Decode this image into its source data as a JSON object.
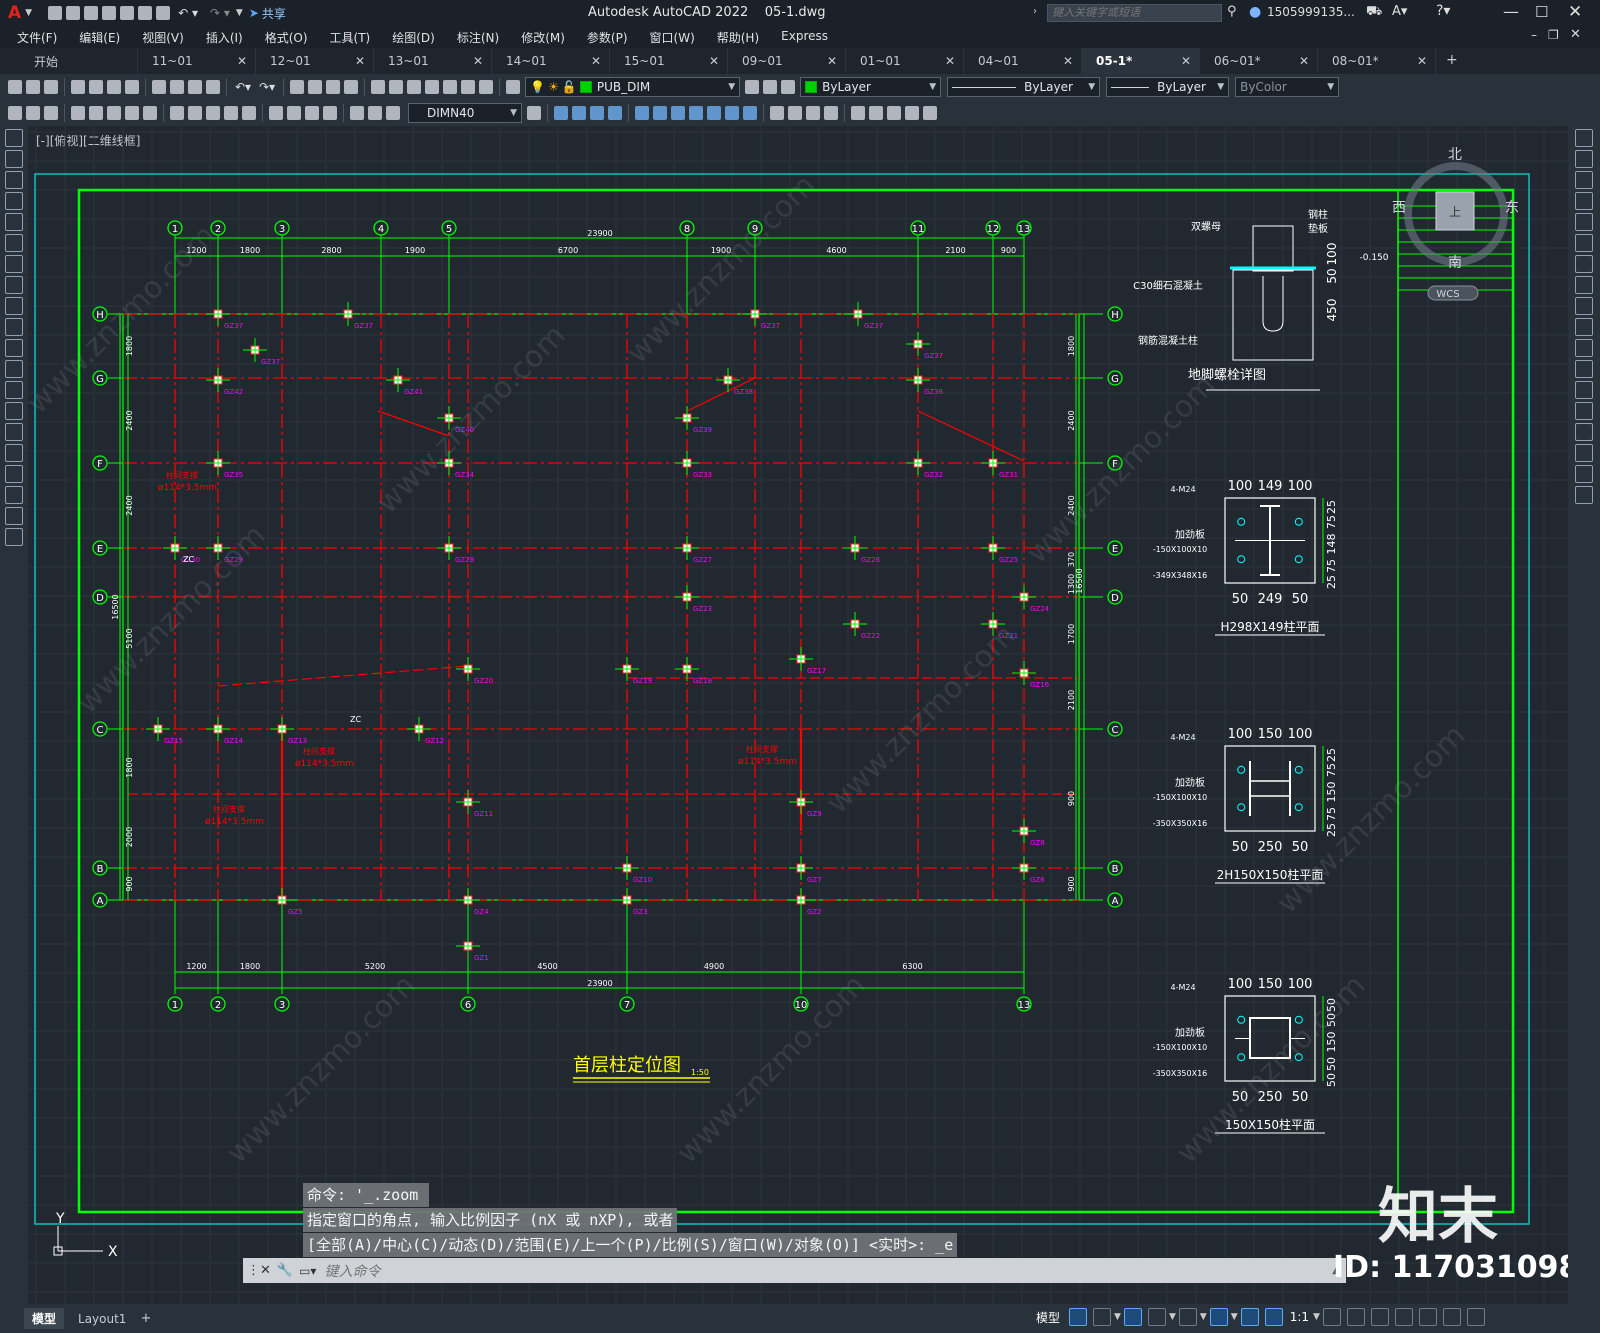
{
  "app": {
    "title": "Autodesk AutoCAD 2022    05-1.dwg",
    "logo": "A",
    "share_label": "共享",
    "search_placeholder": "键入关键字或短语",
    "user": "1505999135...",
    "colors": {
      "accent": "#0078d7",
      "model_bg": "#212830",
      "grid_green": "#00ff00",
      "column_red": "#ff0000",
      "label_magenta": "#ff00ff",
      "text_white": "#ffffff",
      "title_yellow": "#ffff00"
    }
  },
  "menu": [
    "文件(F)",
    "编辑(E)",
    "视图(V)",
    "插入(I)",
    "格式(O)",
    "工具(T)",
    "绘图(D)",
    "标注(N)",
    "修改(M)",
    "参数(P)",
    "窗口(W)",
    "帮助(H)",
    "Express"
  ],
  "tabs": [
    {
      "label": "开始",
      "closable": false,
      "active": false
    },
    {
      "label": "11~01",
      "closable": true,
      "active": false
    },
    {
      "label": "12~01",
      "closable": true,
      "active": false
    },
    {
      "label": "13~01",
      "closable": true,
      "active": false
    },
    {
      "label": "14~01",
      "closable": true,
      "active": false
    },
    {
      "label": "15~01",
      "closable": true,
      "active": false
    },
    {
      "label": "09~01",
      "closable": true,
      "active": false
    },
    {
      "label": "01~01",
      "closable": true,
      "active": false
    },
    {
      "label": "04~01",
      "closable": true,
      "active": false
    },
    {
      "label": "05-1*",
      "closable": true,
      "active": true
    },
    {
      "label": "06~01*",
      "closable": true,
      "active": false
    },
    {
      "label": "08~01*",
      "closable": true,
      "active": false
    }
  ],
  "toolbar": {
    "layer": "PUB_DIM",
    "color": "ByLayer",
    "linetype": "ByLayer",
    "lineweight": "ByLayer",
    "plotstyle": "ByColor",
    "dimstyle": "DIMN40"
  },
  "viewport_label": "[-][俯视][二维线框]",
  "viewcube": {
    "north": "北",
    "south": "南",
    "east": "东",
    "west": "西",
    "top": "上",
    "wcs": "WCS"
  },
  "drawing": {
    "plan_title": "首层柱定位图",
    "plan_scale": "1:50",
    "col_axes": [
      {
        "label": "1"
      },
      {
        "label": "2"
      },
      {
        "label": "3"
      },
      {
        "label": "4"
      },
      {
        "label": "5"
      },
      {
        "label": "8"
      },
      {
        "label": "9"
      },
      {
        "label": "11"
      },
      {
        "label": "12"
      },
      {
        "label": "13"
      }
    ],
    "bottom_axes": [
      {
        "label": "1"
      },
      {
        "label": "2"
      },
      {
        "label": "3"
      },
      {
        "label": "6"
      },
      {
        "label": "7"
      },
      {
        "label": "10"
      },
      {
        "label": "13"
      }
    ],
    "row_axes": [
      {
        "label": "H"
      },
      {
        "label": "G"
      },
      {
        "label": "F"
      },
      {
        "label": "E"
      },
      {
        "label": "D"
      },
      {
        "label": "C"
      },
      {
        "label": "B"
      },
      {
        "label": "A"
      }
    ],
    "top_dims": [
      "1200",
      "1800",
      "2800",
      "1900",
      "6700",
      "1900",
      "4600",
      "2100",
      "900"
    ],
    "top_total": "23900",
    "bottom_dims": [
      "1200",
      "1800",
      "5200",
      "4500",
      "4900",
      "6300"
    ],
    "bottom_total": "23900",
    "left_dims": [
      "1800",
      "2400",
      "2400",
      "5100",
      "1800",
      "2000",
      "900"
    ],
    "left_total": "16500",
    "right_dims": [
      "1800",
      "2400",
      "2400",
      "370",
      "1300",
      "1700",
      "2100",
      "900",
      "900"
    ],
    "right_total": "16500",
    "columns": [
      {
        "id": "GZ37"
      },
      {
        "id": "GZ37"
      },
      {
        "id": "GZ37"
      },
      {
        "id": "GZ37"
      },
      {
        "id": "GZ37"
      },
      {
        "id": "GZ37"
      },
      {
        "id": "GZ42"
      },
      {
        "id": "GZ41"
      },
      {
        "id": "GZ40"
      },
      {
        "id": "GZ39"
      },
      {
        "id": "GZ38"
      },
      {
        "id": "GZ36"
      },
      {
        "id": "GZ35"
      },
      {
        "id": "GZ34"
      },
      {
        "id": "GZ33"
      },
      {
        "id": "GZ32"
      },
      {
        "id": "GZ31"
      },
      {
        "id": "GZ30"
      },
      {
        "id": "GZ29"
      },
      {
        "id": "GZ28"
      },
      {
        "id": "GZ27"
      },
      {
        "id": "GZ26"
      },
      {
        "id": "GZ25"
      },
      {
        "id": "GZ24"
      },
      {
        "id": "GZ23"
      },
      {
        "id": "GZ22"
      },
      {
        "id": "GZ21"
      },
      {
        "id": "GZ20"
      },
      {
        "id": "GZ19"
      },
      {
        "id": "GZ18"
      },
      {
        "id": "GZ17"
      },
      {
        "id": "GZ16"
      },
      {
        "id": "GZ15"
      },
      {
        "id": "GZ14"
      },
      {
        "id": "GZ13"
      },
      {
        "id": "GZ12"
      },
      {
        "id": "GZ11"
      },
      {
        "id": "GZ9"
      },
      {
        "id": "GZ8"
      },
      {
        "id": "GZ10"
      },
      {
        "id": "GZ7"
      },
      {
        "id": "GZ6"
      },
      {
        "id": "GZ5"
      },
      {
        "id": "GZ4"
      },
      {
        "id": "GZ3"
      },
      {
        "id": "GZ2"
      },
      {
        "id": "GZ1"
      }
    ],
    "brace_labels": [
      "柱间支撑",
      "ø114*3.5mm"
    ],
    "zc": "ZC",
    "anchor": {
      "title": "地脚螺栓详图",
      "labels": [
        "双螺母",
        "钢柱",
        "垫板",
        "C30细石混凝土",
        "钢筋混凝土柱"
      ],
      "dims": [
        "-0.150",
        "50",
        "100",
        "450"
      ]
    },
    "sections": [
      {
        "title": "H298X149柱平面",
        "top_dims": [
          "100",
          "149",
          "100"
        ],
        "bottom_dims": [
          "50",
          "249",
          "50"
        ],
        "side_dims": [
          "25",
          "75",
          "148",
          "75",
          "25"
        ],
        "bolt": "4-M24",
        "plate1": "加劲板",
        "plate2": "-150X100X10",
        "base": "-349X348X16"
      },
      {
        "title": "2H150X150柱平面",
        "top_dims": [
          "100",
          "150",
          "100"
        ],
        "bottom_dims": [
          "50",
          "250",
          "50"
        ],
        "side_dims": [
          "25",
          "75",
          "150",
          "75",
          "25"
        ],
        "bolt": "4-M24",
        "plate1": "加劲板",
        "plate2": "-150X100X10",
        "base": "-350X350X16"
      },
      {
        "title": "150X150柱平面",
        "top_dims": [
          "100",
          "150",
          "100"
        ],
        "bottom_dims": [
          "50",
          "250",
          "50"
        ],
        "side_dims": [
          "50",
          "50",
          "150",
          "50",
          "50"
        ],
        "bolt": "4-M24",
        "plate1": "加劲板",
        "plate2": "-150X100X10",
        "base": "-350X350X16"
      }
    ]
  },
  "command": {
    "history": [
      "命令: '_.zoom",
      "指定窗口的角点, 输入比例因子 (nX 或 nXP), 或者",
      "[全部(A)/中心(C)/动态(D)/范围(E)/上一个(P)/比例(S)/窗口(W)/对象(O)] <实时>: _e"
    ],
    "placeholder": "键入命令"
  },
  "layouts": [
    "模型",
    "Layout1",
    "+"
  ],
  "status": {
    "model": "模型",
    "scale": "1:1"
  },
  "watermark": {
    "text": "www.znzmo.com",
    "brand": "知末",
    "id": "ID: 1170310987"
  }
}
